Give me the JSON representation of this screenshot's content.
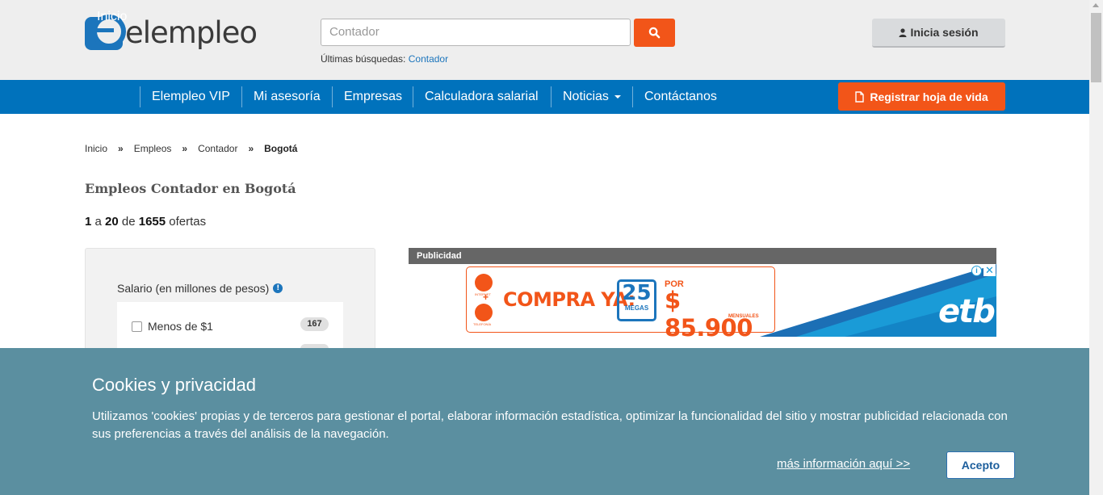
{
  "header": {
    "logo_text": "elempleo",
    "search": {
      "placeholder": "Contador"
    },
    "recent_label": "Últimas búsquedas:",
    "recent_link": "Contador",
    "login_label": "Inicia sesión"
  },
  "nav": {
    "items": [
      "Inicio",
      "Elempleo VIP",
      "Mi asesoría",
      "Empresas",
      "Calculadora salarial",
      "Noticias",
      "Contáctanos"
    ],
    "register_label": "Registrar hoja de vida"
  },
  "breadcrumb": [
    "Inicio",
    "Empleos",
    "Contador",
    "Bogotá"
  ],
  "breadcrumb_sep": "»",
  "page_title": "Empleos Contador en Bogotá",
  "results": {
    "from": "1",
    "a": "a",
    "to": "20",
    "de": "de",
    "total": "1655",
    "suffix": "ofertas"
  },
  "filter": {
    "title": "Salario (en millones de pesos)",
    "options": [
      {
        "label": "Menos de $1",
        "count": "167"
      }
    ]
  },
  "ad": {
    "label": "Publicidad",
    "headline": "COMPRA YA:",
    "megas_num": "25",
    "megas_text": "MEGAS",
    "por": "POR",
    "price": "$ 85.900",
    "mensuales": "MENSUALES",
    "internet": "INTERNET",
    "telefonia": "TELEFONÍA",
    "brand": "etb"
  },
  "cookies": {
    "title": "Cookies y privacidad",
    "text": "Utilizamos 'cookies' propias y de terceros para gestionar el portal, elaborar información estadística, optimizar la funcionalidad del sitio y mostrar publicidad relacionada con sus preferencias a través del análisis de la navegación.",
    "more_link": "más información aquí >>",
    "accept_label": "Acepto"
  },
  "colors": {
    "brand_blue": "#0072bc",
    "accent_orange": "#f25519",
    "cookie_bg": "#5b8fa0"
  }
}
